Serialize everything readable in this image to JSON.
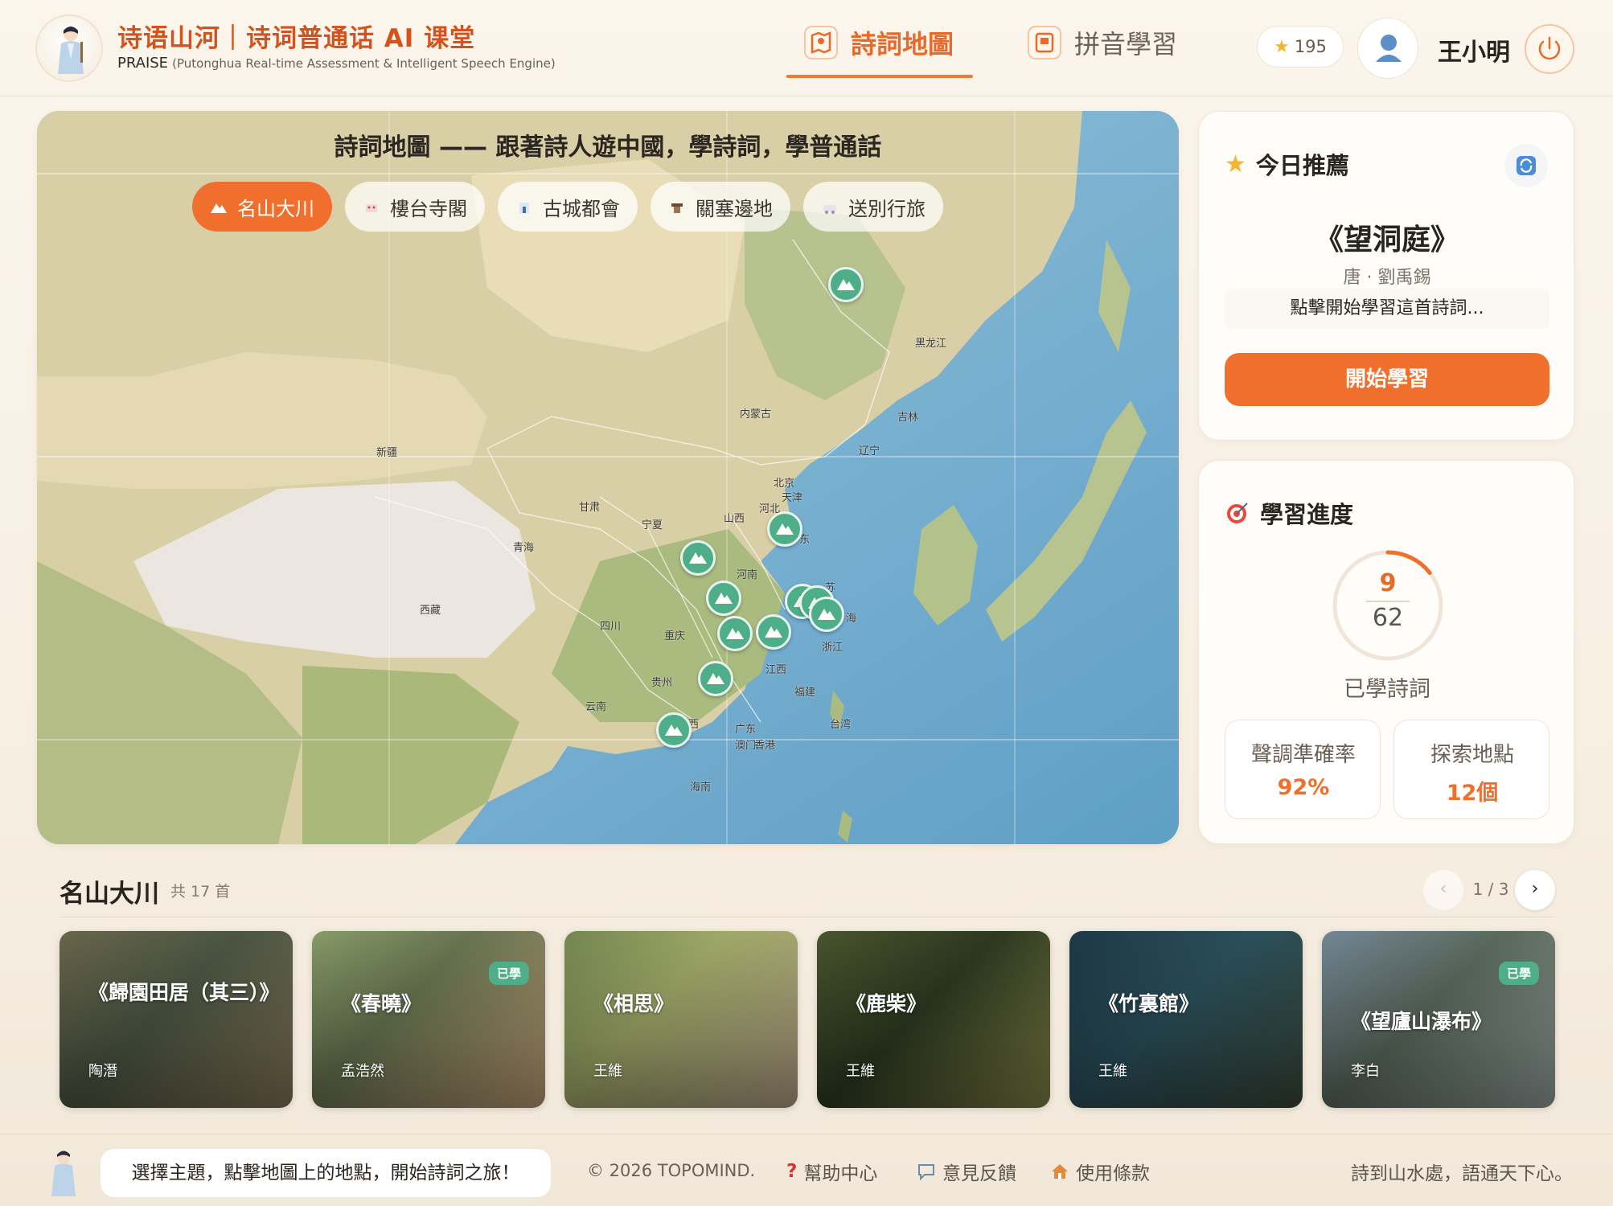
{
  "header": {
    "brand_title": "诗语山河｜诗词普通话 AI 课堂",
    "brand_sub_main": "PRAISE",
    "brand_sub_expansion": "(Putonghua Real-time Assessment & Intelligent Speech Engine)",
    "tabs": [
      {
        "label": "詩詞地圖",
        "active": true
      },
      {
        "label": "拼音學習",
        "active": false
      }
    ],
    "stars": "195",
    "user_name": "王小明"
  },
  "map": {
    "title": "詩詞地圖 —— 跟著詩人遊中國，學詩詞，學普通話",
    "categories": [
      {
        "label": "名山大川",
        "active": true,
        "icon": "mountain-icon"
      },
      {
        "label": "樓台寺閣",
        "active": false,
        "icon": "pavilion-icon"
      },
      {
        "label": "古城都會",
        "active": false,
        "icon": "city-icon"
      },
      {
        "label": "關塞邊地",
        "active": false,
        "icon": "fortress-icon"
      },
      {
        "label": "送別行旅",
        "active": false,
        "icon": "travel-icon"
      }
    ],
    "place_labels": {
      "heilongjiang": "黑龙江",
      "jilin": "吉林",
      "neimenggu": "内蒙古",
      "liaoning": "辽宁",
      "xinjiang": "新疆",
      "beijing": "北京",
      "tianjin": "天津",
      "hebei": "河北",
      "gansu": "甘肃",
      "ningxia": "宁夏",
      "shanxi": "山西",
      "qinghai": "青海",
      "shandong": "东",
      "henan": "河南",
      "jiangsu": "苏",
      "xizang": "西藏",
      "sichuan": "四川",
      "chongqing": "重庆",
      "shanghai": "海",
      "zhejiang": "浙江",
      "jiangxi": "江西",
      "guizhou": "贵州",
      "fujian": "福建",
      "yunnan": "云南",
      "guangxi": "西",
      "guangdong": "广东",
      "aomen": "澳门",
      "xianggang": "香港",
      "taiwan": "台湾",
      "hainan": "海南"
    }
  },
  "recommend": {
    "heading": "今日推薦",
    "poem_title": "《望洞庭》",
    "poem_author": "唐 · 劉禹錫",
    "hint": "點擊開始學習這首詩詞...",
    "start_label": "開始學習"
  },
  "progress": {
    "heading": "學習進度",
    "learned": "9",
    "total": "62",
    "learned_fraction": 0.145,
    "label": "已學詩詞",
    "stats": [
      {
        "label": "聲調準確率",
        "value": "92%"
      },
      {
        "label": "探索地點",
        "value": "12個"
      }
    ]
  },
  "list": {
    "title": "名山大川",
    "count": "共 17 首",
    "page": "1 / 3",
    "cards": [
      {
        "title": "《歸園田居（其三）》",
        "author": "陶潛",
        "learned": false
      },
      {
        "title": "《春曉》",
        "author": "孟浩然",
        "learned": true
      },
      {
        "title": "《相思》",
        "author": "王維",
        "learned": false
      },
      {
        "title": "《鹿柴》",
        "author": "王維",
        "learned": false
      },
      {
        "title": "《竹裏館》",
        "author": "王維",
        "learned": false
      },
      {
        "title": "《望廬山瀑布》",
        "author": "李白",
        "learned": true
      }
    ],
    "learned_badge": "已學"
  },
  "footer": {
    "bubble": "選擇主題，點擊地圖上的地點，開始詩詞之旅！",
    "copyright": "© 2026 TOPOMIND.",
    "links": [
      {
        "label": "幫助中心",
        "icon": "question-icon"
      },
      {
        "label": "意見反饋",
        "icon": "chat-icon"
      },
      {
        "label": "使用條款",
        "icon": "house-icon"
      }
    ],
    "slogan": "詩到山水處，語通天下心。"
  },
  "colors": {
    "accent": "#f16f2c",
    "accent_text": "#e8692a",
    "brand_red": "#d4521c",
    "marker_green": "#4fae8a"
  }
}
